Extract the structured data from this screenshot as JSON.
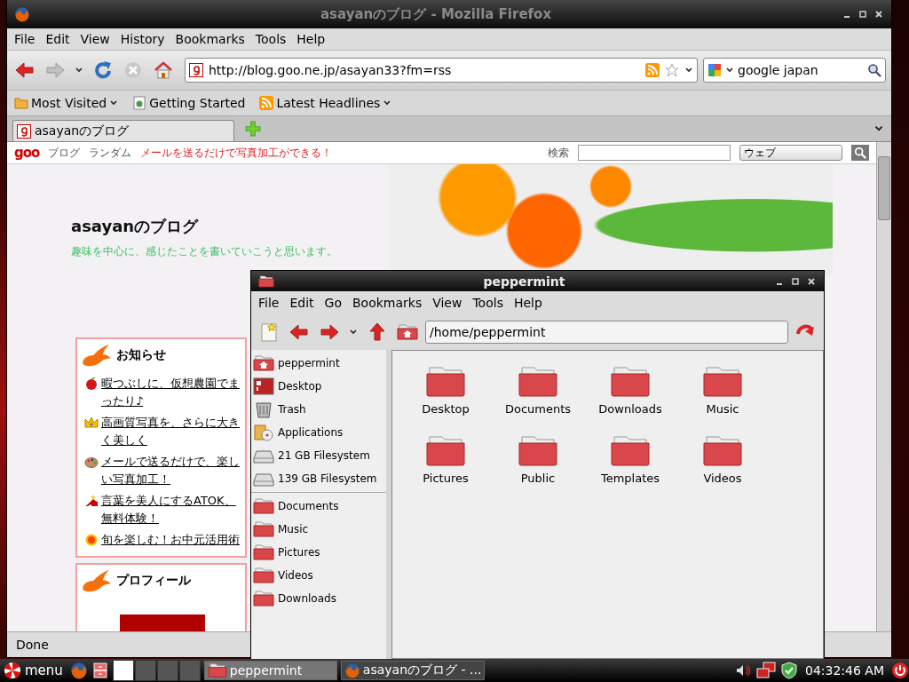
{
  "firefox": {
    "title": "asayanのブログ - Mozilla Firefox",
    "menu": [
      "File",
      "Edit",
      "View",
      "History",
      "Bookmarks",
      "Tools",
      "Help"
    ],
    "address": "http://blog.goo.ne.jp/asayan33?fm=rss",
    "search": "google japan",
    "bookmarks": [
      {
        "label": "Most Visited",
        "kind": "folder",
        "dropdown": true
      },
      {
        "label": "Getting Started",
        "kind": "page",
        "dropdown": false
      },
      {
        "label": "Latest Headlines",
        "kind": "feed",
        "dropdown": true
      }
    ],
    "tabs": [
      {
        "label": "asayanのブログ",
        "selected": true
      }
    ],
    "page": {
      "goo_bar": {
        "logo": "goo",
        "links": [
          "ブログ",
          "ランダム"
        ],
        "promo": "メールを送るだけで写真加工ができる！",
        "search_label": "検索",
        "search_scope": "ウェブ"
      },
      "blog_title": "asayanのブログ",
      "blog_subtitle": "趣味を中心に、感じたことを書いていこうと思います。",
      "boxes": [
        {
          "title": "お知らせ",
          "items": [
            "暇つぶしに、仮想農園でまったり♪",
            "高画質写真を、さらに大きく美しく",
            "メールで送るだけで、楽しい写真加工！",
            "言葉を美人にするATOK、無料体験！",
            "旬を楽しむ！お中元活用術"
          ]
        },
        {
          "title": "プロフィール"
        }
      ]
    },
    "status": "Done"
  },
  "file_manager": {
    "title": "peppermint",
    "menu": [
      "File",
      "Edit",
      "Go",
      "Bookmarks",
      "View",
      "Tools",
      "Help"
    ],
    "location": "/home/peppermint",
    "places": [
      {
        "label": "peppermint",
        "kind": "home"
      },
      {
        "label": "Desktop",
        "kind": "desktop"
      },
      {
        "label": "Trash",
        "kind": "trash"
      },
      {
        "label": "Applications",
        "kind": "applications"
      },
      {
        "label": "21 GB Filesystem",
        "kind": "drive"
      },
      {
        "label": "139 GB Filesystem",
        "kind": "drive"
      }
    ],
    "bookmarks": [
      "Documents",
      "Music",
      "Pictures",
      "Videos",
      "Downloads"
    ],
    "files": [
      "Desktop",
      "Documents",
      "Downloads",
      "Music",
      "Pictures",
      "Public",
      "Templates",
      "Videos"
    ]
  },
  "taskbar": {
    "menu_label": "menu",
    "workspaces": [
      {
        "selected": true
      },
      {
        "selected": false
      },
      {
        "selected": false
      },
      {
        "selected": false
      }
    ],
    "tasks": [
      {
        "label": "peppermint",
        "kind": "folder",
        "selected": true
      },
      {
        "label": "asayanのブログ - ...",
        "kind": "browser",
        "selected": false
      }
    ],
    "clock": "04:32:46 AM"
  }
}
